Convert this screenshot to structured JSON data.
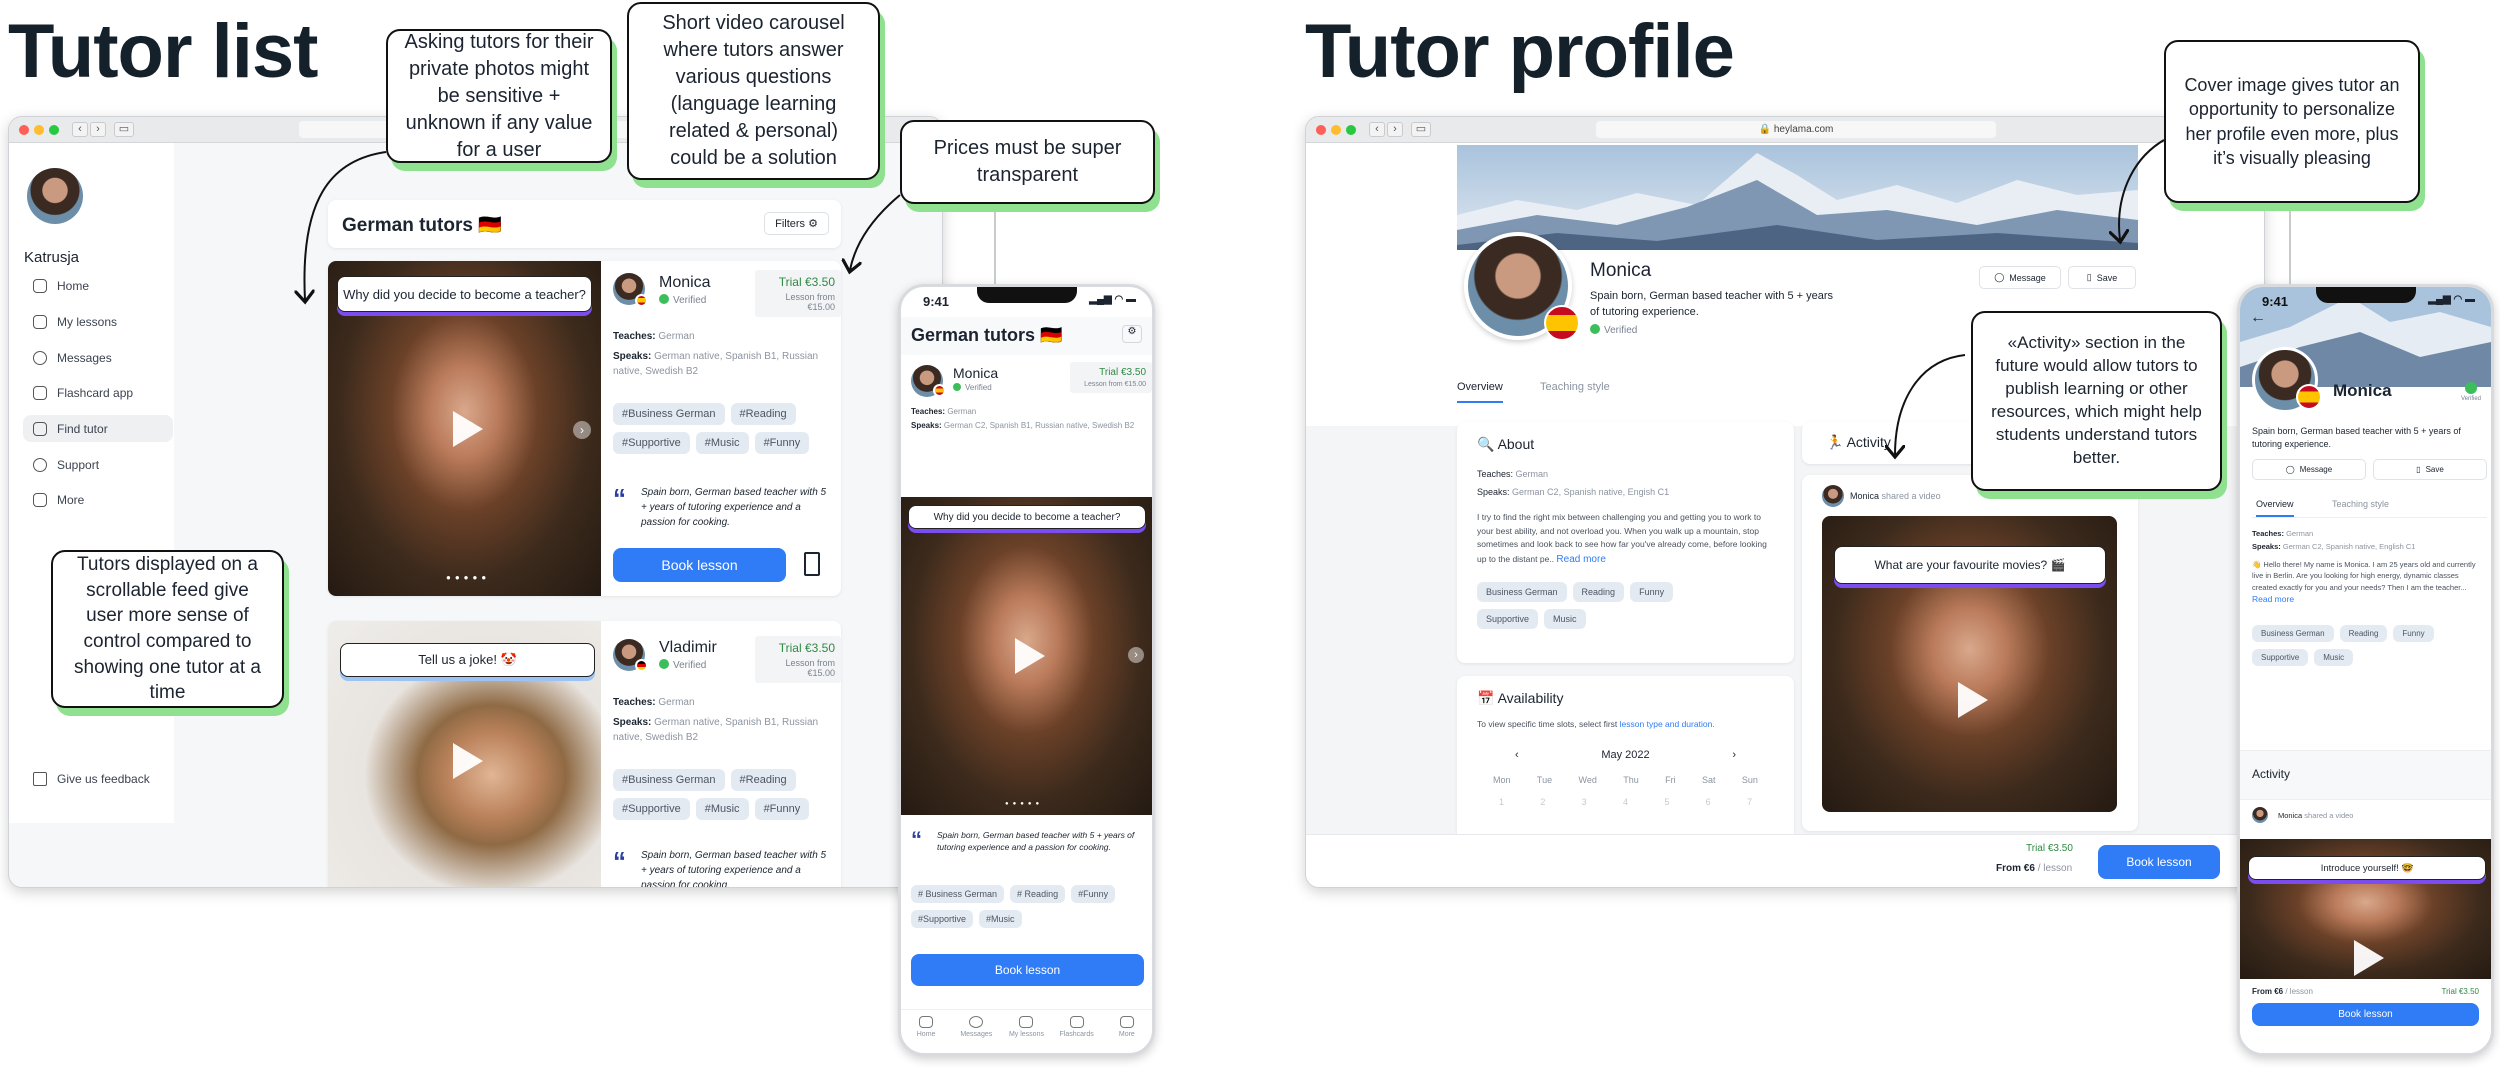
{
  "left": {
    "title": "Tutor list",
    "callouts": [
      "Asking tutors for their private photos might be sensitive + unknown if any value for a user",
      "Short video carousel where tutors answer various questions (language learning related & personal) could be a solution",
      "Prices must be super transparent",
      "Tutors displayed on a scrollable feed give user more sense of control compared to showing one tutor at a time"
    ],
    "desktop": {
      "user_name": "Katrusja",
      "nav": [
        "Home",
        "My lessons",
        "Messages",
        "Flashcard app",
        "Find tutor",
        "Support",
        "More"
      ],
      "active_nav": "Find tutor",
      "feedback": "Give us feedback",
      "header_title": "German tutors 🇩🇪",
      "filters": "Filters",
      "tutors": [
        {
          "name": "Monica",
          "verified": "Verified",
          "trial": "Trial €3.50",
          "lesson_from": "Lesson from €15.00",
          "question": "Why did you decide to become a teacher?",
          "teaches_label": "Teaches:",
          "teaches": "German",
          "speaks_label": "Speaks:",
          "speaks": "German native, Spanish B1, Russian native, Swedish B2",
          "tags": [
            "#Business German",
            "#Reading",
            "#Supportive",
            "#Music",
            "#Funny"
          ],
          "quote": "Spain born, German based teacher with 5 + years of tutoring experience and a passion for cooking.",
          "book": "Book lesson"
        },
        {
          "name": "Vladimir",
          "verified": "Verified",
          "trial": "Trial €3.50",
          "lesson_from": "Lesson from €15.00",
          "question": "Tell us a joke! 🤡",
          "teaches_label": "Teaches:",
          "teaches": "German",
          "speaks_label": "Speaks:",
          "speaks": "German native, Spanish B1, Russian native, Swedish B2",
          "tags": [
            "#Business German",
            "#Reading",
            "#Supportive",
            "#Music",
            "#Funny"
          ],
          "quote": "Spain born, German based teacher with 5 + years of tutoring experience and a passion for cooking."
        }
      ]
    },
    "mobile": {
      "time": "9:41",
      "title": "German tutors 🇩🇪",
      "tutor": {
        "name": "Monica",
        "verified": "Verified",
        "trial": "Trial €3.50",
        "lesson_from": "Lesson from €15.00",
        "teaches_label": "Teaches:",
        "teaches": "German",
        "speaks_label": "Speaks:",
        "speaks": "German C2, Spanish B1, Russian native, Swedish B2",
        "question": "Why did you decide to become a teacher?",
        "quote": "Spain born, German based teacher with 5 + years of tutoring experience and a passion for cooking.",
        "tags": [
          "# Business German",
          "# Reading",
          "#Funny",
          "#Supportive",
          "#Music"
        ],
        "book": "Book lesson"
      },
      "tabbar": [
        "Home",
        "Messages",
        "My lessons",
        "Flashcards",
        "More"
      ]
    }
  },
  "right": {
    "title": "Tutor profile",
    "callouts": [
      "Cover image gives tutor an opportunity to personalize her profile even more, plus it’s visually pleasing",
      "«Activity» section in the future would allow tutors to publish learning or other resources, which might help students understand tutors better."
    ],
    "desktop": {
      "url": "heylama.com",
      "name": "Monica",
      "bio": "Spain born, German based teacher with 5 + years of tutoring experience.",
      "verified": "Verified",
      "message": "Message",
      "save": "Save",
      "tabs": [
        "Overview",
        "Teaching style"
      ],
      "about": {
        "title": "About",
        "teaches_label": "Teaches:",
        "teaches": "German",
        "speaks_label": "Speaks:",
        "speaks": "German C2, Spanish native, Engish C1",
        "text": "I try to find the right mix between challenging you and getting you to work to your best ability, and not overload you. When you walk up a mountain, stop sometimes and look back to see how far you've already come, before looking up to the distant pe..",
        "read_more": "Read more",
        "tags": [
          "Business German",
          "Reading",
          "Funny",
          "Supportive",
          "Music"
        ]
      },
      "availability": {
        "title": "Availability",
        "hint": "To view specific time slots, select first",
        "link": "lesson type and duration.",
        "month": "May 2022",
        "weekdays": [
          "Mon",
          "Tue",
          "Wed",
          "Thu",
          "Fri",
          "Sat",
          "Sun"
        ],
        "days": [
          "1",
          "2",
          "3",
          "4",
          "5",
          "6",
          "7"
        ]
      },
      "activity": {
        "title": "Activity",
        "author": "Monica",
        "action": "shared a video",
        "question": "What are your favourite movies? 🎬"
      },
      "footer": {
        "trial": "Trial €3.50",
        "from": "From €6",
        "per": "/ lesson",
        "book": "Book lesson"
      }
    },
    "mobile": {
      "time": "9:41",
      "name": "Monica",
      "verified": "Verified",
      "bio": "Spain born, German based teacher with 5 + years of tutoring experience.",
      "message": "Message",
      "save": "Save",
      "tabs": [
        "Overview",
        "Teaching style"
      ],
      "teaches_label": "Teaches:",
      "teaches": "German",
      "speaks_label": "Speaks:",
      "speaks": "German C2, Spanish native, English C1",
      "text": "👋 Hello there! My name is Monica. I am 25 years old and currently live in Berlin. Are you looking for high energy, dynamic classes created exactly for you and your needs? Then I am the teacher...",
      "read_more": "Read more",
      "tags": [
        "Business German",
        "Reading",
        "Funny",
        "Supportive",
        "Music"
      ],
      "activity_title": "Activity",
      "author": "Monica",
      "action": "shared a video",
      "question": "Introduce yourself! 🤓",
      "from": "From €6",
      "per": "/ lesson",
      "trial": "Trial €3.50",
      "book": "Book lesson"
    }
  },
  "colors": {
    "accent": "#2f7cf6",
    "trial_green": "#2f8a44",
    "callout_shadow": "#8fe08f",
    "question_underline": "#7b4cf0"
  }
}
